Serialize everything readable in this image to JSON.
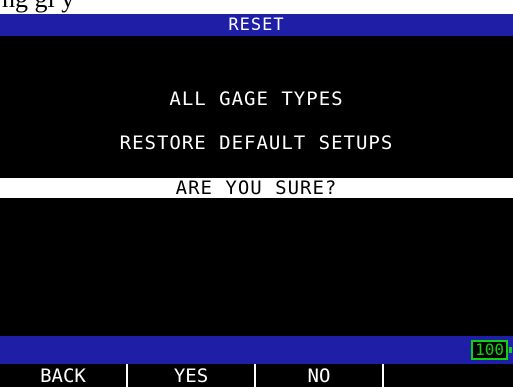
{
  "header_fragment": "ng gi          y",
  "title": "RESET",
  "message": {
    "line1": "ALL GAGE TYPES",
    "line2": "RESTORE DEFAULT SETUPS"
  },
  "prompt": "ARE YOU SURE?",
  "status": {
    "battery_level": "100"
  },
  "softkeys": [
    {
      "label": "BACK"
    },
    {
      "label": "YES"
    },
    {
      "label": "NO"
    },
    {
      "label": ""
    }
  ],
  "colors": {
    "title_bar": "#1e1ea6",
    "panel": "#000000",
    "text": "#ffffff",
    "battery": "#10d010"
  }
}
